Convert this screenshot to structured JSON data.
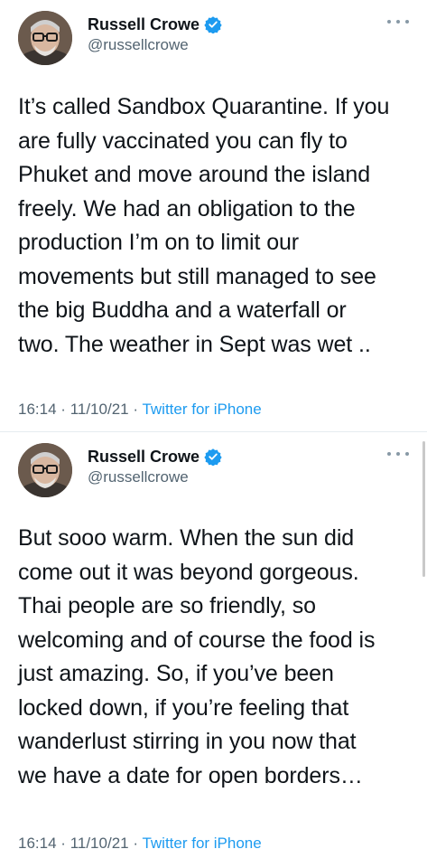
{
  "theme": {
    "text": "#0f1419",
    "secondary_text": "#536471",
    "link": "#1d9bf0",
    "verified_badge": "#1d9bf0"
  },
  "tweets": [
    {
      "author": {
        "name": "Russell Crowe",
        "handle": "@russellcrowe",
        "verified": true,
        "avatar_icon": "avatar-photo"
      },
      "text": "It’s called Sandbox Quarantine. If you\nare fully vaccinated you can fly to\nPhuket and move around the island\nfreely. We had an obligation to the\nproduction I’m on to limit our\nmovements but still managed to see\nthe big Buddha and a waterfall or\ntwo. The weather in Sept was wet ..",
      "time": "16:14",
      "separator": "·",
      "date": "11/10/21",
      "source": "Twitter for iPhone"
    },
    {
      "author": {
        "name": "Russell Crowe",
        "handle": "@russellcrowe",
        "verified": true,
        "avatar_icon": "avatar-photo"
      },
      "text": "But sooo warm. When the sun did\ncome out it was beyond gorgeous.\nThai people are so friendly, so\nwelcoming and of course the food is\njust amazing. So, if you’ve been\nlocked down, if you’re feeling that\nwanderlust stirring in you now that\nwe have a date for open borders…",
      "time": "16:14",
      "separator": "·",
      "date": "11/10/21",
      "source": "Twitter for iPhone"
    }
  ]
}
